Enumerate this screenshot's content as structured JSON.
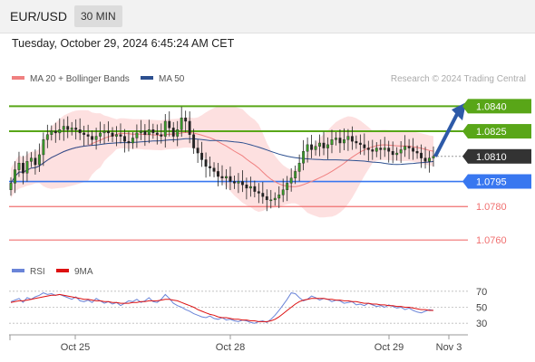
{
  "header": {
    "pair": "EUR/USD",
    "timeframe": "30 MIN"
  },
  "datetime": "Tuesday, October 29, 2024 6:45:24 AM CET",
  "legend": {
    "ma20_label": "MA 20 + Bollinger Bands",
    "ma20_color": "#f08080",
    "ma50_label": "MA 50",
    "ma50_color": "#2c4f8f",
    "credit": "Research © 2024 Trading Central"
  },
  "rsi_legend": {
    "rsi_label": "RSI",
    "rsi_color": "#6a84d8",
    "ma9_label": "9MA",
    "ma9_color": "#dd1111"
  },
  "colors": {
    "green": "#59a618",
    "blue": "#3877f0",
    "red": "#f07070",
    "dark": "#333333",
    "arrow": "#2e5aa8",
    "bollinger_fill": "#fcd8d8"
  },
  "chart_data": [
    {
      "type": "candlestick",
      "title": "EUR/USD",
      "ylim": [
        1.0752,
        1.0851
      ],
      "levels": [
        {
          "value": 1.084,
          "label": "1.0840",
          "style": "green-box"
        },
        {
          "value": 1.0825,
          "label": "1.0825",
          "style": "green-box"
        },
        {
          "value": 1.081,
          "label": "1.0810",
          "style": "dark-box"
        },
        {
          "value": 1.0795,
          "label": "1.0795",
          "style": "blue-box"
        },
        {
          "value": 1.078,
          "label": "1.0780",
          "style": "red-text"
        },
        {
          "value": 1.076,
          "label": "1.0760",
          "style": "red-text"
        }
      ],
      "x_ticks": [
        "Oct 25",
        "Oct 28",
        "Oct 29",
        "Nov 3"
      ],
      "series": [
        {
          "name": "MA 20 + Bollinger Bands"
        },
        {
          "name": "MA 50"
        }
      ],
      "closes": [
        1.0794,
        1.0802,
        1.0806,
        1.08,
        1.0807,
        1.0809,
        1.0805,
        1.0811,
        1.082,
        1.0823,
        1.0825,
        1.0824,
        1.0826,
        1.0828,
        1.0826,
        1.0827,
        1.0826,
        1.0824,
        1.0823,
        1.0822,
        1.082,
        1.0822,
        1.0824,
        1.0825,
        1.0824,
        1.0822,
        1.0823,
        1.0822,
        1.0819,
        1.0818,
        1.0821,
        1.0824,
        1.0825,
        1.0823,
        1.0826,
        1.0824,
        1.0823,
        1.0822,
        1.0831,
        1.0827,
        1.0822,
        1.0826,
        1.0833,
        1.0831,
        1.0823,
        1.0815,
        1.0812,
        1.0808,
        1.0804,
        1.0803,
        1.0801,
        1.0798,
        1.0797,
        1.0798,
        1.0795,
        1.0794,
        1.0795,
        1.0793,
        1.0791,
        1.0792,
        1.0789,
        1.0788,
        1.0786,
        1.0784,
        1.0784,
        1.0785,
        1.0787,
        1.079,
        1.0794,
        1.0797,
        1.0801,
        1.0806,
        1.0813,
        1.0817,
        1.0814,
        1.0816,
        1.0818,
        1.0815,
        1.0817,
        1.082,
        1.0821,
        1.0818,
        1.082,
        1.0822,
        1.0819,
        1.0818,
        1.0817,
        1.0815,
        1.0814,
        1.0813,
        1.0815,
        1.0814,
        1.0815,
        1.0813,
        1.0811,
        1.0812,
        1.0814,
        1.0816,
        1.0815,
        1.0813,
        1.0812,
        1.0809,
        1.0807,
        1.0809,
        1.081
      ],
      "subchart": {
        "type": "line",
        "ylim": [
          20,
          80
        ],
        "y_ticks": [
          70,
          50,
          30
        ],
        "series": [
          {
            "name": "RSI",
            "values": [
              57,
              59,
              61,
              56,
              62,
              60,
              63,
              65,
              68,
              66,
              67,
              65,
              66,
              64,
              62,
              60,
              63,
              58,
              57,
              59,
              56,
              61,
              58,
              55,
              57,
              54,
              56,
              52,
              55,
              58,
              57,
              60,
              56,
              58,
              62,
              57,
              56,
              60,
              66,
              61,
              55,
              52,
              50,
              47,
              45,
              42,
              40,
              38,
              37,
              39,
              36,
              35,
              37,
              34,
              35,
              33,
              32,
              34,
              33,
              31,
              30,
              32,
              33,
              31,
              35,
              40,
              46,
              53,
              60,
              68,
              67,
              62,
              58,
              60,
              64,
              62,
              59,
              61,
              60,
              57,
              59,
              58,
              55,
              56,
              57,
              53,
              54,
              52,
              55,
              53,
              51,
              52,
              50,
              53,
              51,
              49,
              50,
              47,
              49,
              46,
              44,
              43,
              45,
              47,
              46
            ]
          },
          {
            "name": "9MA",
            "values": [
              56,
              57,
              58,
              58,
              59,
              60,
              61,
              62,
              63,
              64,
              65,
              65,
              66,
              65,
              64,
              63,
              62,
              61,
              60,
              60,
              59,
              58,
              58,
              57,
              57,
              56,
              56,
              55,
              55,
              55,
              56,
              56,
              57,
              57,
              58,
              58,
              58,
              59,
              60,
              60,
              59,
              58,
              56,
              54,
              52,
              50,
              47,
              45,
              43,
              41,
              40,
              38,
              37,
              37,
              36,
              35,
              35,
              34,
              34,
              33,
              33,
              32,
              32,
              32,
              33,
              35,
              38,
              42,
              46,
              50,
              54,
              57,
              59,
              60,
              61,
              61,
              61,
              61,
              60,
              60,
              59,
              59,
              58,
              58,
              57,
              57,
              56,
              55,
              55,
              54,
              54,
              53,
              53,
              52,
              52,
              51,
              51,
              50,
              50,
              49,
              48,
              47,
              47,
              46,
              46
            ]
          }
        ]
      }
    }
  ]
}
